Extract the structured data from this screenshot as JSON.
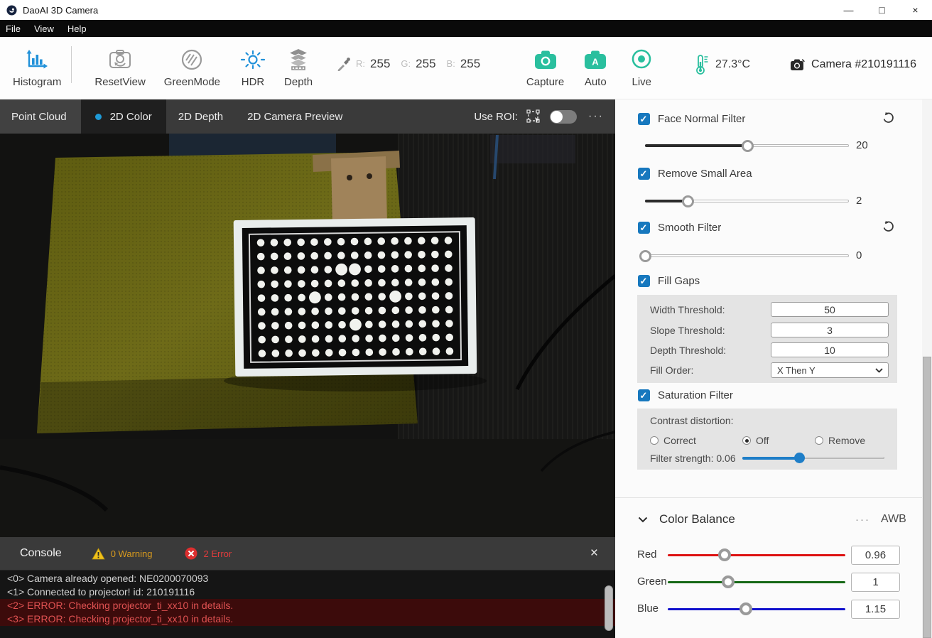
{
  "window": {
    "title": "DaoAI 3D Camera",
    "minimize": "—",
    "maximize": "□",
    "close": "×"
  },
  "menu": {
    "items": [
      {
        "label": "File"
      },
      {
        "label": "View"
      },
      {
        "label": "Help"
      }
    ]
  },
  "toolbar": {
    "histogram": "Histogram",
    "reset_view": "ResetView",
    "green_mode": "GreenMode",
    "hdr": "HDR",
    "depth": "Depth",
    "rgb": {
      "r_label": "R:",
      "r": "255",
      "g_label": "G:",
      "g": "255",
      "b_label": "B:",
      "b": "255"
    },
    "capture": "Capture",
    "auto": "Auto",
    "live": "Live",
    "temperature": "27.3°C",
    "camera_id": "Camera #210191116"
  },
  "tabs": {
    "point_cloud": "Point Cloud",
    "color_2d": "2D Color",
    "depth_2d": "2D Depth",
    "preview_2d": "2D Camera Preview",
    "use_roi_label": "Use ROI:",
    "more": "···"
  },
  "viewport": {
    "board": {
      "rows": 9,
      "cols": 15,
      "big_dots": [
        [
          2,
          6
        ],
        [
          2,
          7
        ],
        [
          4,
          4
        ],
        [
          4,
          10
        ],
        [
          6,
          7
        ]
      ]
    }
  },
  "panel": {
    "filters": [
      {
        "label": "Face Normal Filter",
        "checked": true,
        "value": "20",
        "percent": 50
      },
      {
        "label": "Remove Small Area",
        "checked": true,
        "value": "2",
        "percent": 21
      },
      {
        "label": "Smooth Filter",
        "checked": true,
        "value": "0",
        "percent": 0
      }
    ],
    "fill_gaps": {
      "label": "Fill Gaps",
      "checked": true,
      "rows": [
        {
          "label": "Width Threshold:",
          "value": "50"
        },
        {
          "label": "Slope Threshold:",
          "value": "3"
        },
        {
          "label": "Depth Threshold:",
          "value": "10"
        }
      ],
      "fill_order_label": "Fill Order:",
      "fill_order_value": "X Then Y"
    },
    "saturation": {
      "label": "Saturation Filter",
      "checked": true,
      "contrast_label": "Contrast distortion:",
      "options": [
        {
          "label": "Correct",
          "selected": false
        },
        {
          "label": "Off",
          "selected": true
        },
        {
          "label": "Remove",
          "selected": false
        }
      ],
      "strength_label": "Filter strength: 0.06",
      "strength_percent": 40
    },
    "color_balance": {
      "title": "Color Balance",
      "more": "···",
      "awb": "AWB",
      "channels": [
        {
          "label": "Red",
          "value": "0.96",
          "percent": 32,
          "color": "#dd1111"
        },
        {
          "label": "Green",
          "value": "1",
          "percent": 34,
          "color": "#156815"
        },
        {
          "label": "Blue",
          "value": "1.15",
          "percent": 44,
          "color": "#1111cc"
        }
      ]
    }
  },
  "console": {
    "title": "Console",
    "warning": "0 Warning",
    "error": "2 Error",
    "close": "×",
    "lines": [
      {
        "text": "<0> Camera already opened: NE0200070093",
        "type": "info"
      },
      {
        "text": "<1> Connected to projector! id: 210191116",
        "type": "info"
      },
      {
        "text": "<2> ERROR: Checking projector_ti_xx10 in details.",
        "type": "error"
      },
      {
        "text": "<3> ERROR: Checking projector_ti_xx10 in details.",
        "type": "error"
      }
    ]
  },
  "colors": {
    "accent_green": "#2abf9e",
    "accent_blue": "#2191d9",
    "checkbox_blue": "#1778be",
    "error_red": "#e23c3c",
    "warning_yellow": "#f0c11a"
  }
}
